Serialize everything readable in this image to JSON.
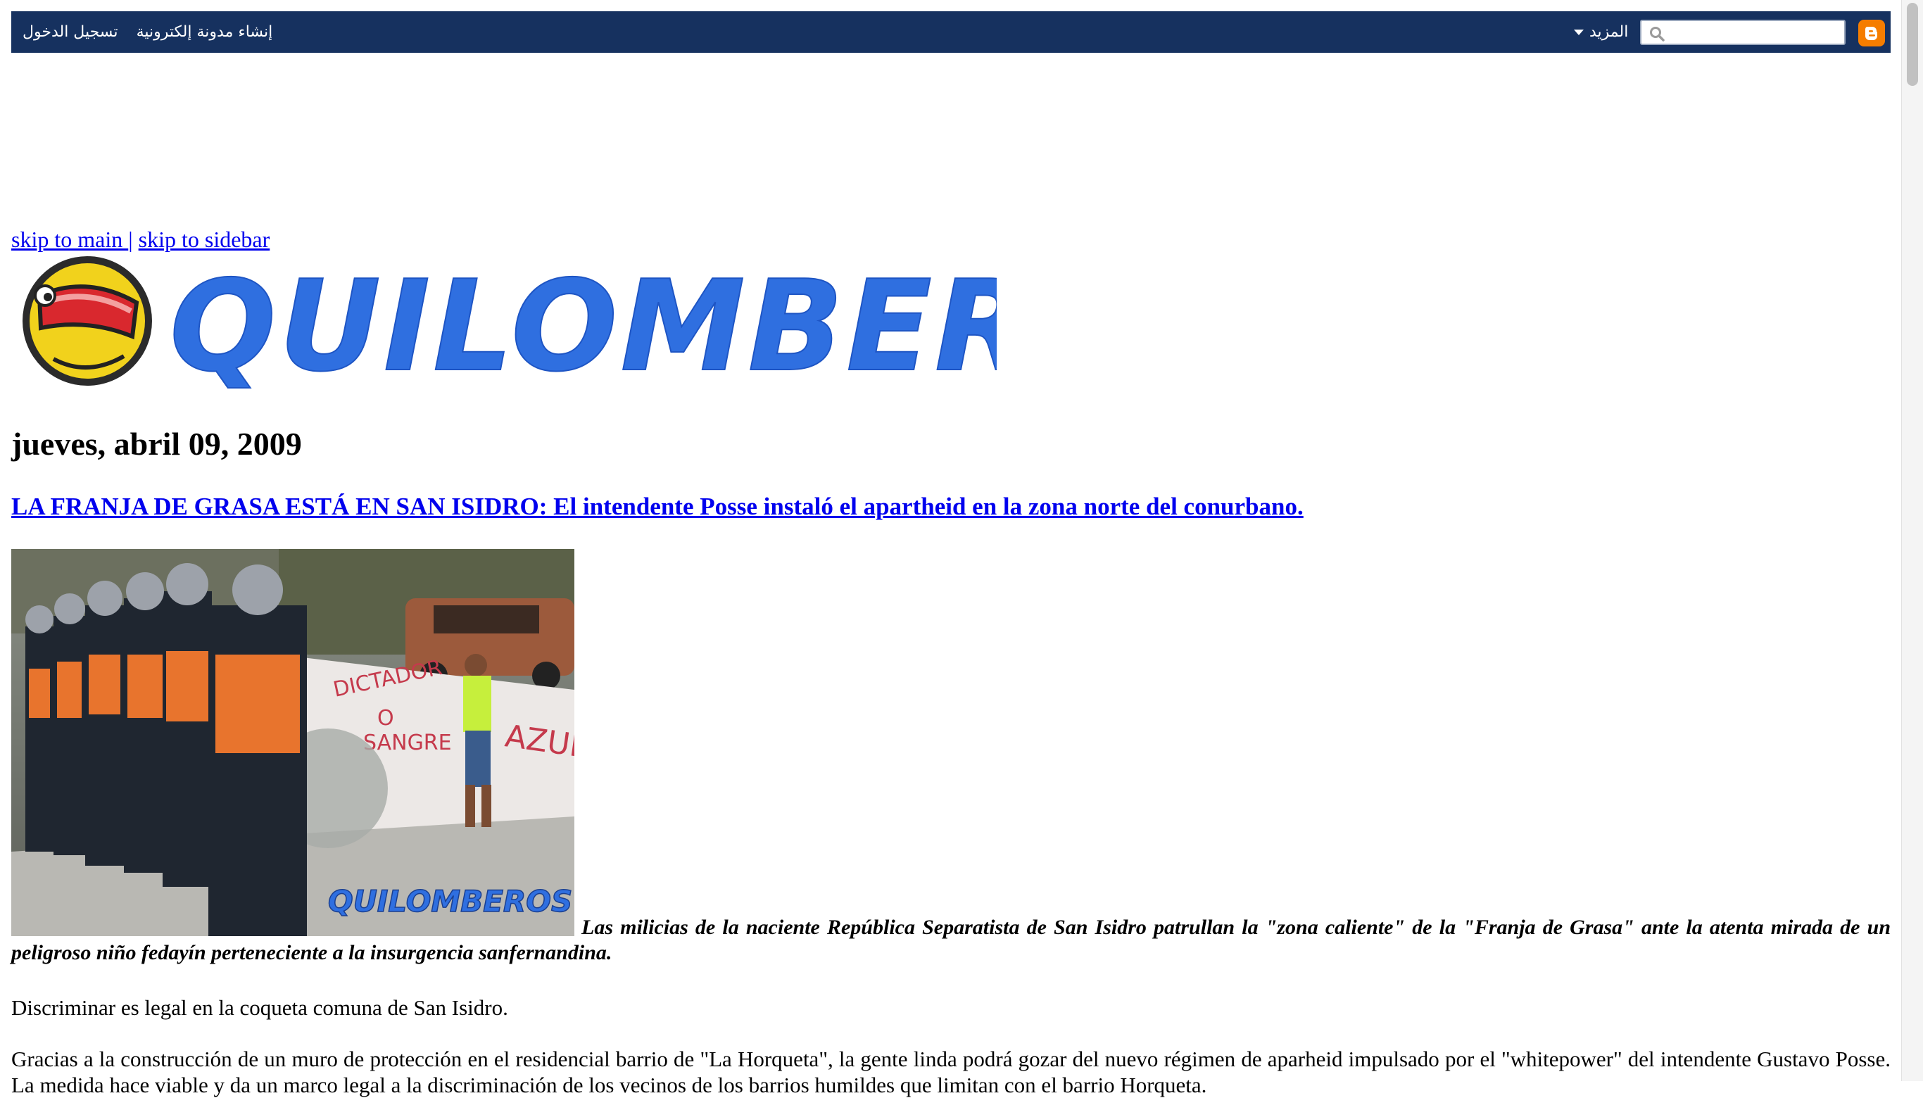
{
  "navbar": {
    "signin_label": "تسجيل الدخول",
    "create_blog_label": "إنشاء مدونة إلكترونية",
    "more_label": "المزيد",
    "search_placeholder": "",
    "colors": {
      "bar": "#16315f",
      "blogger_orange": "#f57d00"
    }
  },
  "skip": {
    "main_label": "skip to main ",
    "separator": "|",
    "sidebar_label": "skip to sidebar"
  },
  "header": {
    "logo_text": "QUILOMBEROS",
    "logo_color": "#2f6fe0"
  },
  "post": {
    "date": "jueves, abril 09, 2009",
    "title": "LA FRANJA DE GRASA ESTÁ EN SAN ISIDRO: El intendente Posse instaló el apartheid en la zona norte del conurbano.",
    "photo": {
      "watermark": "QUILOMBEROS",
      "graffiti": [
        "DICTADOR",
        "O",
        "SANGRE",
        "AZUL"
      ]
    },
    "caption": "Las milicias de la naciente República Separatista de San Isidro patrullan la \"zona caliente\" de la \"Franja de Grasa\" ante la atenta mirada de un peligroso niño fedayín perteneciente a la insurgencia sanfernandina.",
    "paragraphs": [
      "Discriminar es legal en la coqueta comuna de San Isidro.",
      "Gracias a la construcción de un muro de protección en el residencial barrio de \"La Horqueta\", la gente linda podrá gozar del nuevo régimen de aparheid impulsado por el \"whitepower\" del intendente Gustavo Posse. La medida hace viable y da un marco legal a la discriminación de los vecinos de los barrios humildes que limitan con el barrio Horqueta."
    ]
  }
}
